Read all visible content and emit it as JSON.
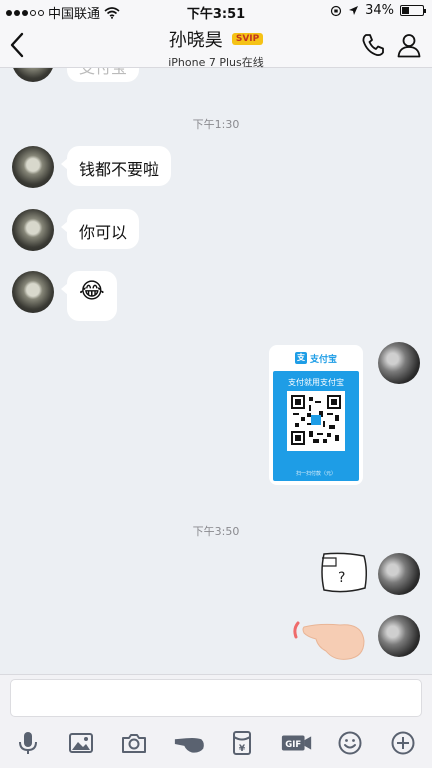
{
  "status_bar": {
    "carrier": "中国联通",
    "time": "下午3:51",
    "battery": "34%",
    "battery_level": 0.34
  },
  "header": {
    "title": "孙晓昊",
    "badge": "SVIP",
    "subtitle": "iPhone 7 Plus在线",
    "back_icon": "chevron-left-icon",
    "call_icon": "phone-icon",
    "profile_icon": "person-icon"
  },
  "chat": {
    "partial_message": "支付宝",
    "time_dividers": [
      "下午1:30",
      "下午3:50"
    ],
    "messages": [
      {
        "sender": "contact",
        "text": "钱都不要啦"
      },
      {
        "sender": "contact",
        "text": "你可以"
      },
      {
        "sender": "contact",
        "emoji": "😂"
      }
    ],
    "qr_card": {
      "brand": "支付宝",
      "brand_sub": "ALIPAY",
      "caption": "支付就用支付宝",
      "footer": "扫一扫付款（元）"
    },
    "stickers": [
      "question-mark-sticker",
      "pointing-hand-sticker"
    ]
  },
  "composer": {
    "input_value": "",
    "placeholder": ""
  },
  "toolbar": {
    "items": [
      "mic-icon",
      "image-icon",
      "camera-icon",
      "poke-icon",
      "red-packet-icon",
      "gif-icon",
      "emoji-icon",
      "add-icon"
    ],
    "gif_label": "GIF",
    "red_packet_label": "¥"
  },
  "colors": {
    "alipay_blue": "#1e9de6",
    "svip_gold": "#f5c216"
  }
}
